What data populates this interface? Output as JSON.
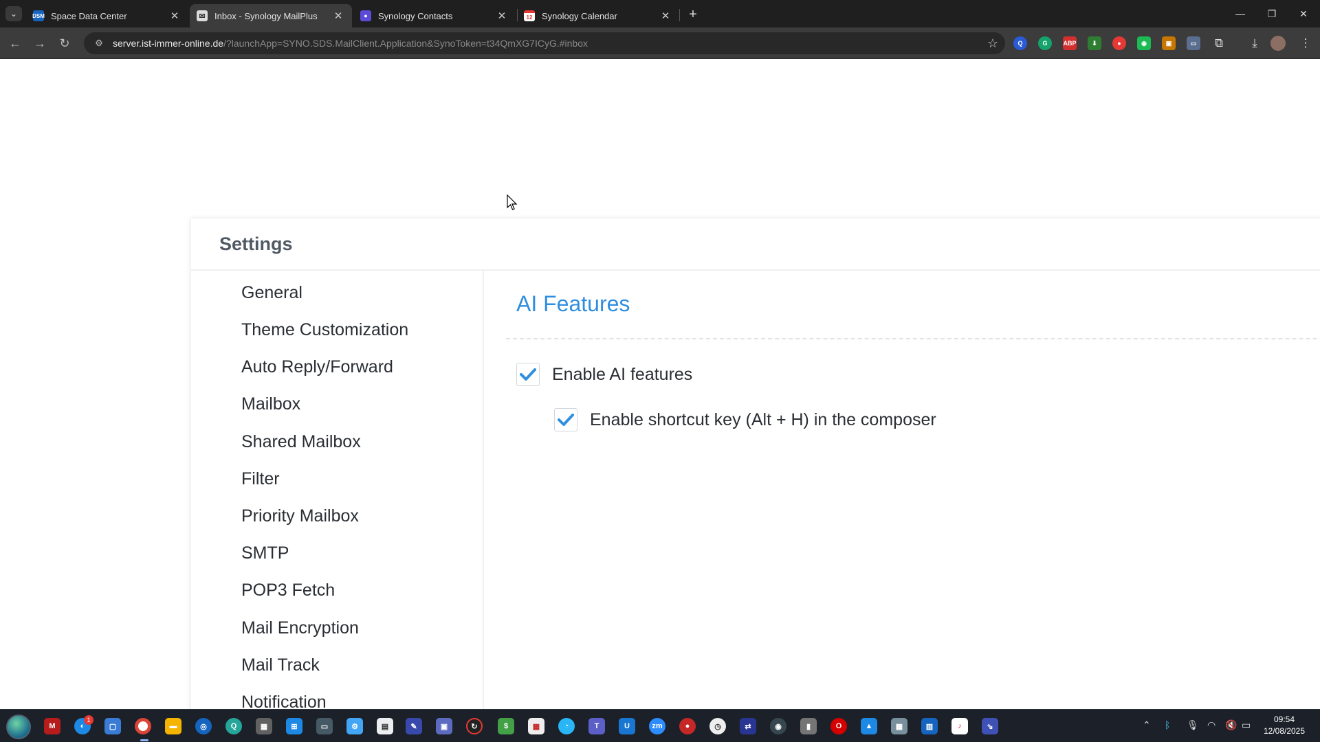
{
  "browser": {
    "tabs": [
      {
        "label": "Space Data Center",
        "favicon": "dsm-favicon",
        "favicon_color": "#1565c0",
        "favicon_text": "DSM"
      },
      {
        "label": "Inbox - Synology MailPlus",
        "favicon": "mail-icon",
        "favicon_color": "#ffffff",
        "favicon_text": "✉",
        "active": true
      },
      {
        "label": "Synology Contacts",
        "favicon": "contacts-icon",
        "favicon_color": "#5c4bd6",
        "favicon_text": "👤"
      },
      {
        "label": "Synology Calendar",
        "favicon": "calendar-icon",
        "favicon_color": "#e53935",
        "favicon_text": "12"
      }
    ],
    "url": {
      "host": "server.ist-immer-online.de",
      "path": "/?launchApp=SYNO.SDS.MailClient.Application&SynoToken=t34QmXG7ICyG.#inbox"
    }
  },
  "settings": {
    "title": "Settings",
    "nav": [
      "General",
      "Theme Customization",
      "Auto Reply/Forward",
      "Mailbox",
      "Shared Mailbox",
      "Filter",
      "Priority Mailbox",
      "SMTP",
      "POP3 Fetch",
      "Mail Encryption",
      "Mail Track",
      "Notification"
    ],
    "section_title": "AI Features",
    "options": [
      {
        "label": "Enable AI features",
        "checked": true
      },
      {
        "label": "Enable shortcut key (Alt + H) in the composer",
        "checked": true
      }
    ],
    "accent_color": "#2f8ee0"
  },
  "taskbar": {
    "time": "09:54",
    "date": "12/08/2025",
    "notification_badge": "1"
  }
}
